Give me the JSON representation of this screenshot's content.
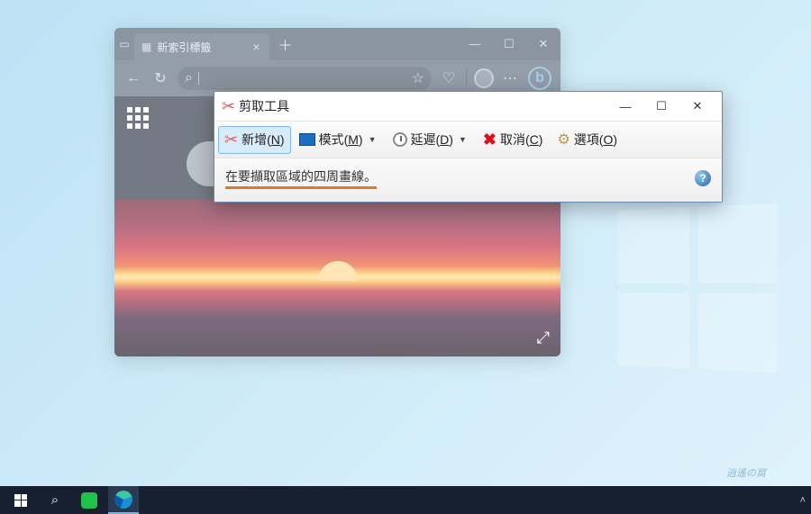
{
  "browser": {
    "tab_label": "新索引標籤",
    "newtab": "＋",
    "controls": {
      "min": "—",
      "max": "☐",
      "close": "✕"
    },
    "toolbar": {
      "back": "←",
      "refresh": "↻",
      "search_icon": "⌕",
      "star": "☆",
      "heart": "♡",
      "dots": "⋯",
      "bing_glyph": "b"
    },
    "expand": "⤢"
  },
  "snip": {
    "title": "剪取工具",
    "controls": {
      "min": "—",
      "max": "☐",
      "close": "✕"
    },
    "toolbar": {
      "new": {
        "label": "新增",
        "accel": "N"
      },
      "mode": {
        "label": "模式",
        "accel": "M"
      },
      "delay": {
        "label": "延遲",
        "accel": "D"
      },
      "cancel": {
        "label": "取消",
        "accel": "C"
      },
      "options": {
        "label": "選項",
        "accel": "O"
      }
    },
    "message": "在要擷取區域的四周畫線。",
    "help": "?"
  },
  "taskbar": {
    "search": "⌕",
    "tray_up": "˄"
  },
  "watermark": "逍遙の窩"
}
